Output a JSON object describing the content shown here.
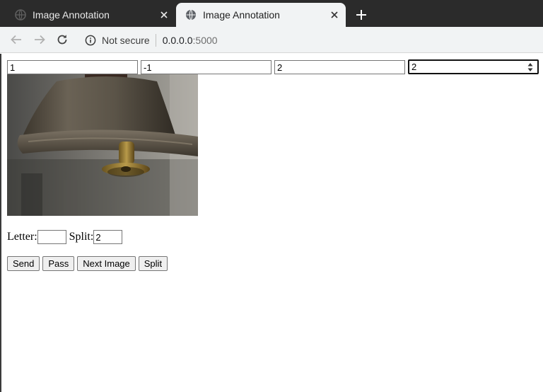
{
  "browser": {
    "tabs": [
      {
        "title": "Image Annotation",
        "active": false
      },
      {
        "title": "Image Annotation",
        "active": true
      }
    ],
    "security_label": "Not secure",
    "url_host": "0.0.0.0",
    "url_port": ":5000"
  },
  "form": {
    "coord_inputs": [
      "1",
      "-1",
      "2"
    ],
    "coord_select_value": "2",
    "letter_label": "Letter:",
    "letter_value": "",
    "split_label": "Split:",
    "split_value": "2"
  },
  "buttons": {
    "send": "Send",
    "pass": "Pass",
    "next_image": "Next Image",
    "split": "Split"
  },
  "colors": {
    "tabstrip_bg": "#2b2b2b",
    "toolbar_bg": "#f1f3f4"
  }
}
